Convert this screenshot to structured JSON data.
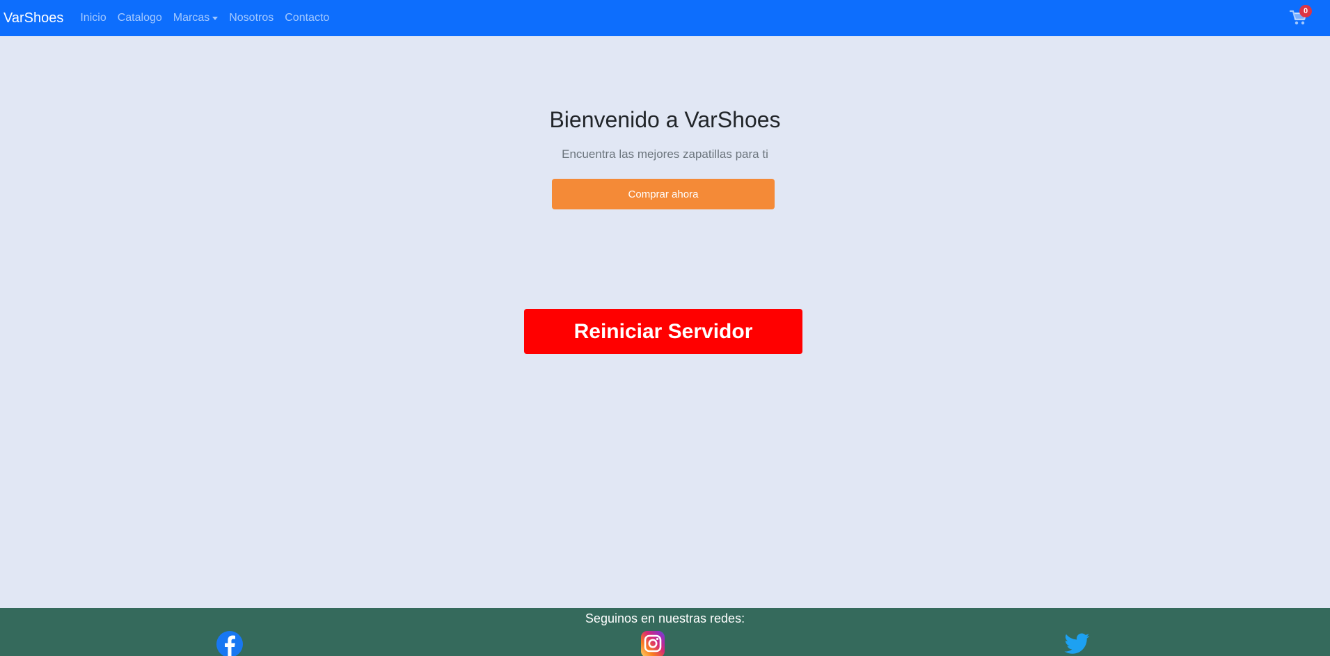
{
  "navbar": {
    "brand": "VarShoes",
    "links": [
      {
        "label": "Inicio"
      },
      {
        "label": "Catalogo"
      },
      {
        "label": "Marcas"
      },
      {
        "label": "Nosotros"
      },
      {
        "label": "Contacto"
      }
    ],
    "cart": {
      "icon": "cart-icon",
      "count": "0"
    }
  },
  "hero": {
    "title": "Bienvenido a VarShoes",
    "subtitle": "Encuentra las mejores zapatillas para ti",
    "cta_label": "Comprar ahora"
  },
  "restart": {
    "label": "Reiniciar Servidor"
  },
  "footer": {
    "title": "Seguinos en nuestras redes:",
    "social": [
      {
        "icon": "facebook-icon"
      },
      {
        "icon": "instagram-icon"
      },
      {
        "icon": "twitter-icon"
      }
    ]
  },
  "colors": {
    "navbar": "#0d6efd",
    "page_background": "#e1e7f4",
    "cta": "#f48a37",
    "restart": "#ff0000",
    "footer": "#356a5c",
    "badge": "#dc3545"
  }
}
